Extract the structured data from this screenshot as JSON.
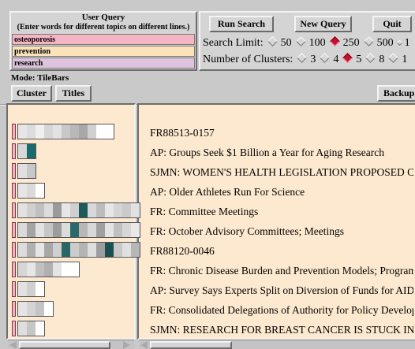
{
  "query_panel": {
    "header_line1": "User Query",
    "header_line2": "(Enter words for different topics on different lines.)",
    "terms": [
      {
        "text": "osteoporosis",
        "color": "#f5b5c5"
      },
      {
        "text": "prevention",
        "color": "#fbe2b8"
      },
      {
        "text": "research",
        "color": "#ddc3dd"
      }
    ]
  },
  "controls": {
    "run_search": "Run Search",
    "new_query": "New Query",
    "quit": "Quit",
    "search_limit_label": "Search Limit:",
    "search_limit_options": [
      "50",
      "100",
      "250",
      "500",
      "1"
    ],
    "search_limit_selected": "250",
    "clusters_label": "Number of Clusters:",
    "cluster_options": [
      "3",
      "4",
      "5",
      "8",
      "1"
    ],
    "clusters_selected": "5"
  },
  "mode": {
    "label": "Mode: TileBars",
    "cluster_button": "Cluster",
    "titles_button": "Titles",
    "backup_button": "Backup"
  },
  "results": [
    {
      "title": "FR88513-0157"
    },
    {
      "title": "AP: Groups Seek $1 Billion a Year for Aging Research"
    },
    {
      "title": "SJMN: WOMEN'S HEALTH LEGISLATION PROPOSED CF"
    },
    {
      "title": "AP: Older Athletes Run For Science"
    },
    {
      "title": "FR: Committee Meetings"
    },
    {
      "title": "FR: October Advisory Committees; Meetings"
    },
    {
      "title": "FR88120-0046"
    },
    {
      "title": "FR: Chronic Disease Burden and Prevention Models; Program A"
    },
    {
      "title": "AP: Survey Says Experts Split on Diversion of Funds for AIDS I"
    },
    {
      "title": "FR: Consolidated Delegations of Authority for Policy Developm"
    },
    {
      "title": "SJMN: RESEARCH FOR BREAST CANCER IS STUCK IN P"
    }
  ],
  "tilebars": [
    {
      "segments": 11,
      "shades": [
        "#e6e6e6",
        "#dcdcdc",
        "#f0f0f0",
        "#d6d6d6",
        "#e2e2e2",
        "#c8c8c8",
        "#b8b8b8",
        "#a8a8a8",
        "#d0d0d0",
        "#ffffff",
        "#ffffff"
      ]
    },
    {
      "segments": 2,
      "shades": [
        "#d8d8d8",
        "#1a6a70"
      ]
    },
    {
      "segments": 2,
      "shades": [
        "#e0e0e0",
        "#c8c8c8"
      ]
    },
    {
      "segments": 3,
      "shades": [
        "#e6e6e6",
        "#dadada",
        "#ffffff"
      ]
    },
    {
      "segments": 14,
      "shades": [
        "#e2e2e2",
        "#d0d0d0",
        "#c0c0c0",
        "#dcdcdc",
        "#9a9a9a",
        "#e6e6e6",
        "#cfcfcf",
        "#1e5a5a",
        "#d8d8d8",
        "#bcbcbc",
        "#e6e6e6",
        "#d4d4d4",
        "#cacaca",
        "#e2e2e2"
      ]
    },
    {
      "segments": 14,
      "shades": [
        "#dadada",
        "#a4a4a4",
        "#e2e2e2",
        "#c6c6c6",
        "#9c9c9c",
        "#dcdcdc",
        "#2a6a6a",
        "#b8b8b8",
        "#d8d8d8",
        "#a0a0a0",
        "#e4e4e4",
        "#c0c0c0",
        "#d6d6d6",
        "#e8e8e8"
      ]
    },
    {
      "segments": 14,
      "shades": [
        "#dcdcdc",
        "#b0b0b0",
        "#e6e6e6",
        "#a8a8a8",
        "#d0d0d0",
        "#2a6666",
        "#cccccc",
        "#b4b4b4",
        "#dedede",
        "#9e9e9e",
        "#1c5050",
        "#c8c8c8",
        "#e0e0e0",
        "#b6b6b6"
      ]
    },
    {
      "segments": 7,
      "shades": [
        "#d6d6d6",
        "#e6e6e6",
        "#c0c0c0",
        "#b0b0b0",
        "#e4e4e4",
        "#ffffff",
        "#ffffff"
      ]
    },
    {
      "segments": 3,
      "shades": [
        "#e2e2e2",
        "#cfcfcf",
        "#ffffff"
      ]
    },
    {
      "segments": 4,
      "shades": [
        "#e4e4e4",
        "#d4d4d4",
        "#c4c4c4",
        "#ffffff"
      ]
    },
    {
      "segments": 3,
      "shades": [
        "#dedede",
        "#c6c6c6",
        "#ffffff"
      ]
    }
  ],
  "colors": {
    "panel_bg": "#fde9cf",
    "window_bg": "#c9c9c9",
    "radio_selected": "#c4102e"
  }
}
